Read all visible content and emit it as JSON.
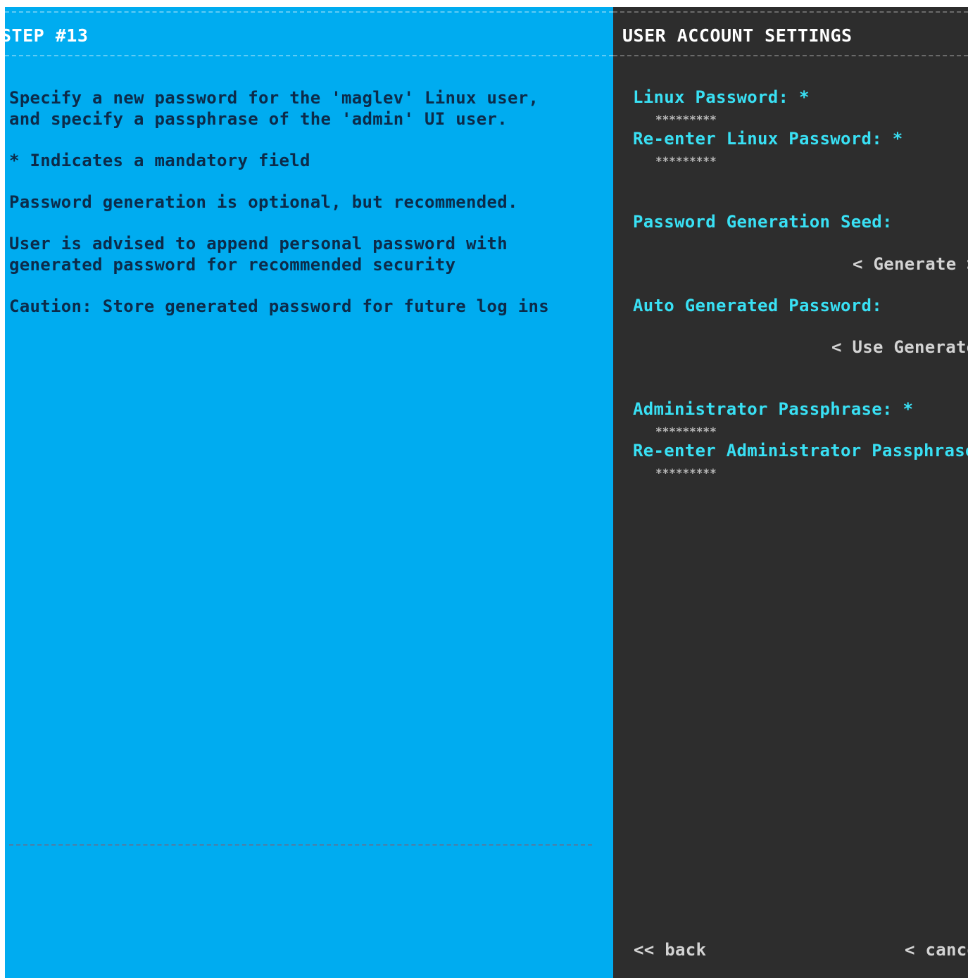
{
  "help": {
    "step_title": "STEP #13",
    "lines": [
      "Specify a new password for the 'maglev' Linux user,\nand specify a passphrase of the 'admin' UI user.",
      "* Indicates a mandatory field",
      "Password generation is optional, but recommended.",
      "User is advised to append personal password with\ngenerated password for recommended security",
      "Caution: Store generated password for future log ins"
    ]
  },
  "settings": {
    "title": "USER ACCOUNT SETTINGS",
    "linux_password": {
      "label": "Linux Password: *",
      "value": "*********"
    },
    "linux_password_confirm": {
      "label": "Re-enter Linux Password: *",
      "value": "*********"
    },
    "seed": {
      "label": "Password Generation Seed:",
      "value": ""
    },
    "generate_button": "< Generate >",
    "auto_password": {
      "label": "Auto Generated Password:",
      "value": ""
    },
    "use_generated_button": "< Use Generated Password >",
    "admin_passphrase": {
      "label": "Administrator Passphrase: *",
      "value": "*********"
    },
    "admin_passphrase_confirm": {
      "label": "Re-enter Administrator Passphrase: *",
      "value": "*********"
    }
  },
  "nav": {
    "back": "<< back",
    "cancel": "< cancel >"
  },
  "colors": {
    "help_background": "#00acf0",
    "settings_background": "#2d2d2d",
    "label_color": "#39e0f4",
    "help_text_color": "#0c2b4a"
  }
}
